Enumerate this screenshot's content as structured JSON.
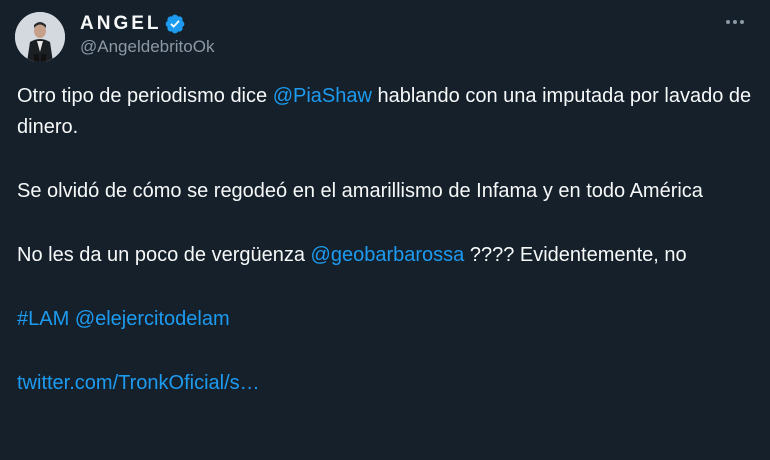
{
  "author": {
    "display_name": "ANGEL",
    "handle": "@AngeldebritoOk",
    "verified": true,
    "avatar": "avatar-photo"
  },
  "menu": {
    "icon": "more-horizontal-icon"
  },
  "colors": {
    "background": "#15202b",
    "text": "#f7f9f9",
    "secondary": "#8b98a5",
    "link": "#1d9bf0"
  },
  "tweet": {
    "p1_a": "Otro tipo de periodismo dice ",
    "p1_mention": "@PiaShaw",
    "p1_b": " hablando con una imputada por lavado de dinero.",
    "p2": "Se olvidó de cómo se regodeó en el amarillismo de Infama y en todo América",
    "p3_a": "No les da un poco de vergüenza ",
    "p3_mention": "@geobarbarossa",
    "p3_b": " ????  Evidentemente, no",
    "p4_hashtag": "#LAM",
    "p4_space": " ",
    "p4_mention": "@elejercitodelam",
    "p5_link": "twitter.com/TronkOficial/s…"
  }
}
